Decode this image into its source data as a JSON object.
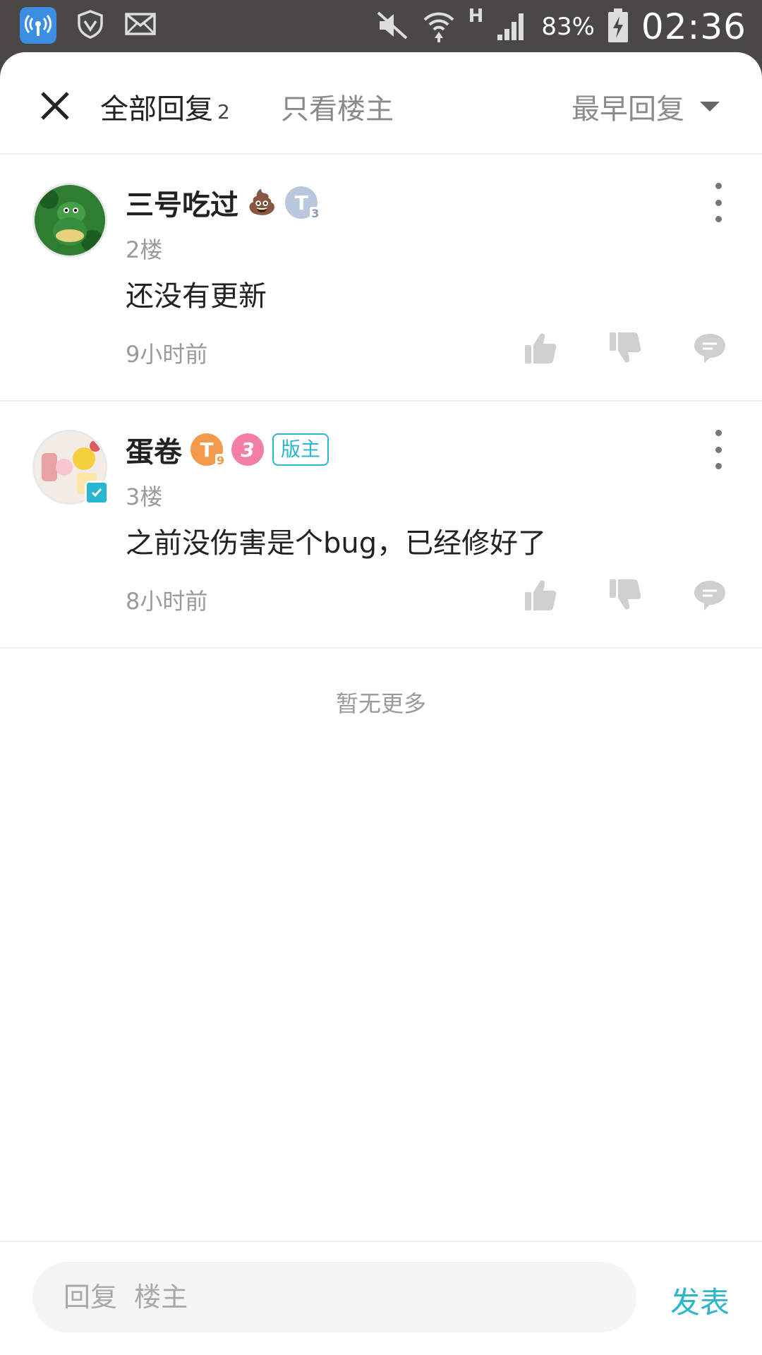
{
  "status_bar": {
    "battery": "83%",
    "time": "02:36",
    "network_label": "H"
  },
  "header": {
    "tab_all_label": "全部回复",
    "tab_all_count": "2",
    "tab_owner_label": "只看楼主",
    "sort_label": "最早回复"
  },
  "replies": [
    {
      "name": "三号吃过",
      "emoji": "💩",
      "level_badge": "T",
      "level_num": "3",
      "floor": "2楼",
      "content": "还没有更新",
      "time": "9小时前"
    },
    {
      "name": "蛋卷",
      "level_badge": "T",
      "level_num": "9",
      "second_badge": "3",
      "mod_label": "版主",
      "floor": "3楼",
      "content": "之前没伤害是个bug，已经修好了",
      "time": "8小时前"
    }
  ],
  "end_text": "暂无更多",
  "composer": {
    "placeholder": "回复  楼主",
    "send_label": "发表"
  },
  "colors": {
    "accent": "#29b6d1",
    "status_bar_bg": "#4a4747",
    "muted_text": "#9a9a9a"
  }
}
